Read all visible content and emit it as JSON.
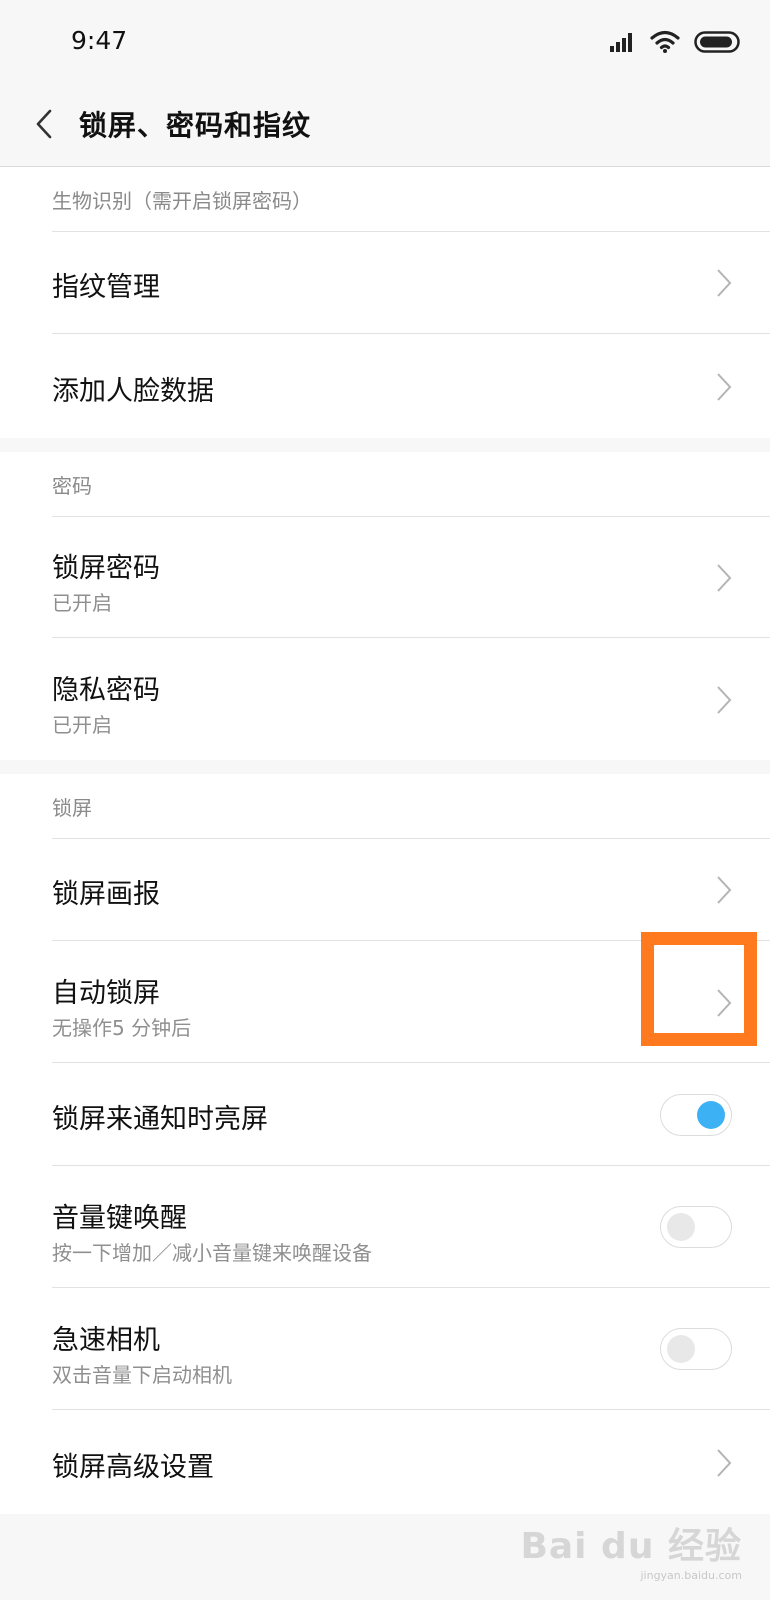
{
  "status_bar": {
    "time": "9:47"
  },
  "header": {
    "title": "锁屏、密码和指纹"
  },
  "sections": {
    "biometric": {
      "header": "生物识别（需开启锁屏密码）",
      "items": [
        {
          "title": "指纹管理"
        },
        {
          "title": "添加人脸数据"
        }
      ]
    },
    "password": {
      "header": "密码",
      "items": [
        {
          "title": "锁屏密码",
          "subtitle": "已开启"
        },
        {
          "title": "隐私密码",
          "subtitle": "已开启"
        }
      ]
    },
    "lockscreen": {
      "header": "锁屏",
      "items": [
        {
          "title": "锁屏画报"
        },
        {
          "title": "自动锁屏",
          "subtitle": "无操作5 分钟后"
        },
        {
          "title": "锁屏来通知时亮屏",
          "toggle": true
        },
        {
          "title": "音量键唤醒",
          "subtitle": "按一下增加／减小音量键来唤醒设备",
          "toggle": false
        },
        {
          "title": "急速相机",
          "subtitle": "双击音量下启动相机",
          "toggle": false
        },
        {
          "title": "锁屏高级设置"
        }
      ]
    }
  },
  "watermark": {
    "logo": "Bai du 经验",
    "url": "jingyan.baidu.com"
  },
  "colors": {
    "accent": "#3cb2f4",
    "highlight": "#ff7a1f",
    "background": "#f7f7f7"
  }
}
